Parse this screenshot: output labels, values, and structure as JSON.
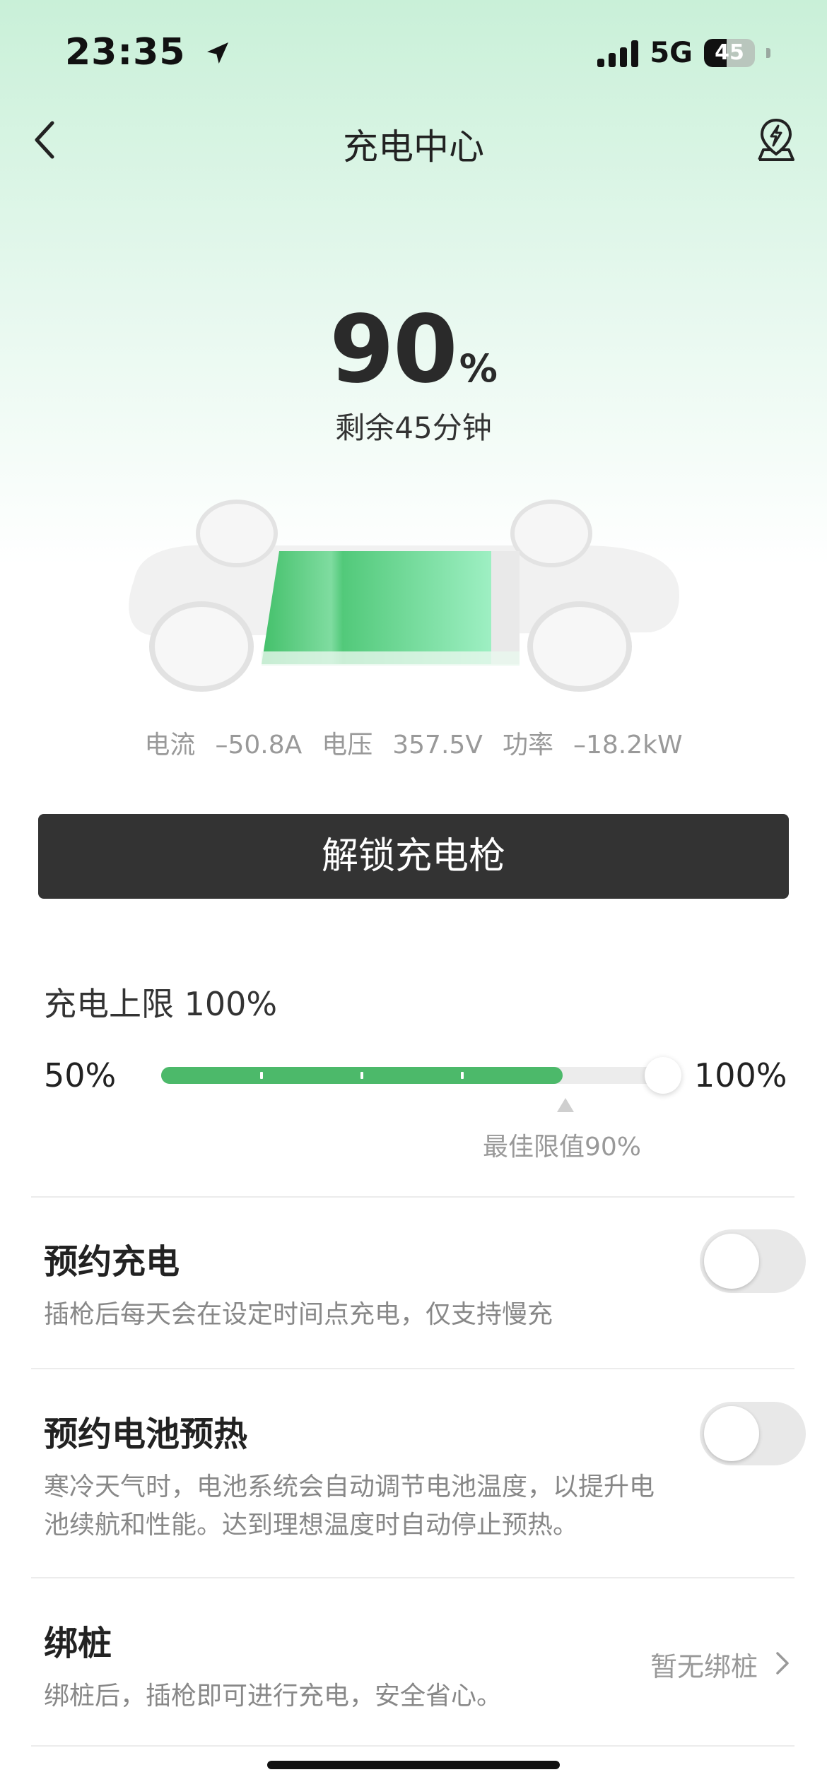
{
  "status": {
    "time": "23:35",
    "network": "5G",
    "battery": "45",
    "battery_level": 0.45,
    "icons": [
      "location-arrow-icon",
      "signal-icon",
      "battery-icon"
    ]
  },
  "nav": {
    "title": "充电中心",
    "icons": [
      "back-chevron-icon",
      "charging-station-map-icon"
    ]
  },
  "charge": {
    "percent": "90",
    "percent_sign": "%",
    "remaining": "剩余45分钟",
    "current_label": "电流",
    "current_value": "–50.8A",
    "voltage_label": "电压",
    "voltage_value": "357.5V",
    "power_label": "功率",
    "power_value": "–18.2kW"
  },
  "unlock_button": "解锁充电枪",
  "limit": {
    "label": "充电上限 100%",
    "min_label": "50%",
    "max_label": "100%",
    "value_percent": 100,
    "fill_percent": 90,
    "best_label": "最佳限值90%"
  },
  "scheduled_charge": {
    "title": "预约充电",
    "desc": "插枪后每天会在设定时间点充电，仅支持慢充",
    "enabled": false
  },
  "preheat": {
    "title": "预约电池预热",
    "desc": "寒冷天气时，电池系统会自动调节电池温度，以提升电池续航和性能。达到理想温度时自动停止预热。",
    "enabled": false
  },
  "bind_pile": {
    "title": "绑桩",
    "desc": "绑桩后，插枪即可进行充电，安全省心。",
    "status": "暂无绑桩"
  },
  "colors": {
    "accent": "#4cb96a",
    "button": "#333333"
  }
}
